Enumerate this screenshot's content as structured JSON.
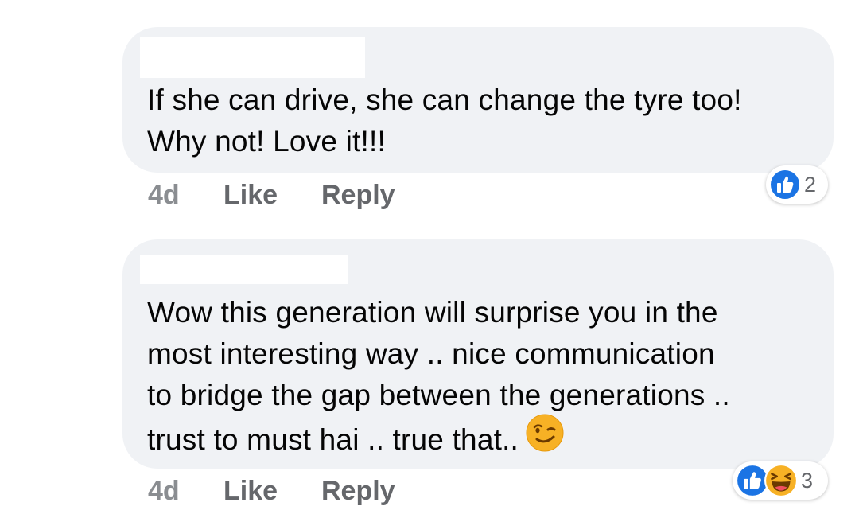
{
  "comments": [
    {
      "text": "If she can drive, she can change the tyre too!\nWhy not! Love it!!!",
      "time": "4d",
      "like_label": "Like",
      "reply_label": "Reply",
      "reactions": [
        "like-icon"
      ],
      "reaction_count": "2"
    },
    {
      "text": "Wow this generation will surprise you in the\nmost interesting way .. nice communication\nto bridge the gap between the generations ..\ntrust to must hai .. true that..",
      "trailing_emoji": "winking-face-icon",
      "time": "4d",
      "like_label": "Like",
      "reply_label": "Reply",
      "reactions": [
        "like-icon",
        "laugh-icon"
      ],
      "reaction_count": "3"
    }
  ],
  "colors": {
    "bubble": "#f0f2f5",
    "like_blue": "#1b74e4",
    "action_gray": "#65676b",
    "emoji_yellow": "#f7b125"
  }
}
